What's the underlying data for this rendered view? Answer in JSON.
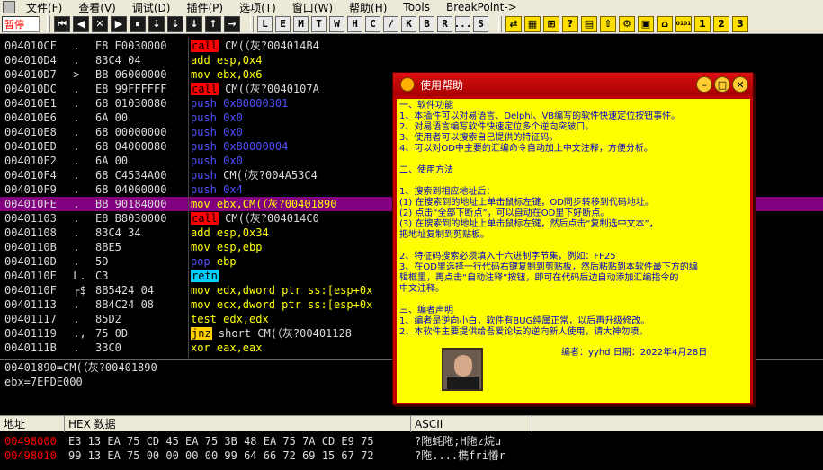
{
  "menu": {
    "items": [
      "文件(F)",
      "查看(V)",
      "调试(D)",
      "插件(P)",
      "选项(T)",
      "窗口(W)",
      "帮助(H)",
      "Tools",
      "BreakPoint->"
    ]
  },
  "toolbar": {
    "status": "暂停",
    "dark_buttons": [
      "⏮",
      "◀",
      "✕",
      "▶",
      "⏸",
      "⇣",
      "⇣",
      "↓",
      "↑",
      "→"
    ],
    "letter_buttons": [
      "L",
      "E",
      "M",
      "T",
      "W",
      "H",
      "C",
      "/",
      "K",
      "B",
      "R",
      "...",
      "S"
    ],
    "yellow_buttons": [
      "⇄",
      "▦",
      "⊞",
      "?",
      "▤",
      "⇧",
      "⚙",
      "▣",
      "⌂",
      "0101",
      "1",
      "2",
      "3"
    ]
  },
  "disasm": {
    "rows": [
      {
        "addr": "004010CF",
        "mark": " .",
        "hex": "E8 E0030000",
        "mn": "call",
        "cls": "kw-call",
        "ops": " CM(（灰?004014B4",
        "ocls": "ops-w"
      },
      {
        "addr": "004010D4",
        "mark": " .",
        "hex": "83C4 04",
        "mn": "add",
        "cls": "ops-y",
        "ops": " esp,0x4",
        "ocls": "ops-y"
      },
      {
        "addr": "004010D7",
        "mark": " >",
        "hex": "BB 06000000",
        "mn": "mov",
        "cls": "ops-y",
        "ops": " ebx,0x6",
        "ocls": "ops-y"
      },
      {
        "addr": "004010DC",
        "mark": " .",
        "hex": "E8 99FFFFFF",
        "mn": "call",
        "cls": "kw-call",
        "ops": " CM(（灰?0040107A",
        "ocls": "ops-w"
      },
      {
        "addr": "004010E1",
        "mark": " .",
        "hex": "68 01030080",
        "mn": "push",
        "cls": "kw-push",
        "ops": " 0x80000301",
        "ocls": "ops-b"
      },
      {
        "addr": "004010E6",
        "mark": " .",
        "hex": "6A 00",
        "mn": "push",
        "cls": "kw-push",
        "ops": " 0x0",
        "ocls": "ops-b"
      },
      {
        "addr": "004010E8",
        "mark": " .",
        "hex": "68 00000000",
        "mn": "push",
        "cls": "kw-push",
        "ops": " 0x0",
        "ocls": "ops-b"
      },
      {
        "addr": "004010ED",
        "mark": " .",
        "hex": "68 04000080",
        "mn": "push",
        "cls": "kw-push",
        "ops": " 0x80000004",
        "ocls": "ops-b"
      },
      {
        "addr": "004010F2",
        "mark": " .",
        "hex": "6A 00",
        "mn": "push",
        "cls": "kw-push",
        "ops": " 0x0",
        "ocls": "ops-b"
      },
      {
        "addr": "004010F4",
        "mark": " .",
        "hex": "68 C4534A00",
        "mn": "push",
        "cls": "kw-push",
        "ops": " CM(（灰?004A53C4",
        "ocls": "ops-w"
      },
      {
        "addr": "004010F9",
        "mark": " .",
        "hex": "68 04000000",
        "mn": "push",
        "cls": "kw-push",
        "ops": " 0x4",
        "ocls": "ops-b"
      },
      {
        "addr": "004010FE",
        "mark": " .",
        "hex": "BB 90184000",
        "mn": "mov",
        "cls": "ops-y",
        "ops": " ebx,CM(（灰?00401890",
        "ocls": "ops-y",
        "sel": true
      },
      {
        "addr": "00401103",
        "mark": " .",
        "hex": "E8 B8030000",
        "mn": "call",
        "cls": "kw-call",
        "ops": " CM(（灰?004014C0",
        "ocls": "ops-w"
      },
      {
        "addr": "00401108",
        "mark": " .",
        "hex": "83C4 34",
        "mn": "add",
        "cls": "ops-y",
        "ops": " esp,0x34",
        "ocls": "ops-y"
      },
      {
        "addr": "0040110B",
        "mark": " .",
        "hex": "8BE5",
        "mn": "mov",
        "cls": "ops-y",
        "ops": " esp,ebp",
        "ocls": "ops-y"
      },
      {
        "addr": "0040110D",
        "mark": " .",
        "hex": "5D",
        "mn": "pop",
        "cls": "kw-push",
        "ops": " ebp",
        "ocls": "ops-y"
      },
      {
        "addr": "0040110E",
        "mark": " L.",
        "hex": "C3",
        "mn": "retn",
        "cls": "kw-ret",
        "ops": "",
        "ocls": "ops-w"
      },
      {
        "addr": "0040110F",
        "mark": " ┌$",
        "hex": "8B5424 04",
        "mn": "mov",
        "cls": "ops-y",
        "ops": " edx,dword ptr ss:[esp+0x",
        "ocls": "ops-y"
      },
      {
        "addr": "00401113",
        "mark": " .",
        "hex": "8B4C24 08",
        "mn": "mov",
        "cls": "ops-y",
        "ops": " ecx,dword ptr ss:[esp+0x",
        "ocls": "ops-y"
      },
      {
        "addr": "00401117",
        "mark": " .",
        "hex": "85D2",
        "mn": "test",
        "cls": "ops-y",
        "ops": " edx,edx",
        "ocls": "ops-y"
      },
      {
        "addr": "00401119",
        "mark": " .,",
        "hex": "75 0D",
        "mn": "jnz",
        "cls": "kw-jnz",
        "ops": " short CM(（灰?00401128",
        "ocls": "ops-w"
      },
      {
        "addr": "0040111B",
        "mark": " .",
        "hex": "33C0",
        "mn": "xor",
        "cls": "ops-y",
        "ops": " eax,eax",
        "ocls": "ops-y"
      }
    ]
  },
  "info": {
    "line1": "00401890=CM(（灰?00401890",
    "line2": "ebx=7EFDE000"
  },
  "dump": {
    "col_addr": "地址",
    "col_hex": "HEX 数据",
    "col_ascii": "ASCII",
    "rows": [
      {
        "addr": "00498000",
        "hex": "E3 13 EA 75 CD 45 EA 75 3B 48 EA 75 7A CD E9 75",
        "ascii": "?陁蚝陁;H陁z烷u"
      },
      {
        "addr": "00498010",
        "hex": "99 13 EA 75 00 00 00 00 99 64 66 72 69 15 67 72",
        "ascii": "?陁....檇fri慻r"
      }
    ]
  },
  "help": {
    "title": "使用帮助",
    "lines": [
      "一、软件功能",
      "1、本插件可以对易语言、Delphi、VB编写的软件快速定位按钮事件。",
      "2、对易语言编写软件快速定位多个逆向突破口。",
      "3、使用者可以搜索自己提供的特征码。",
      "4、可以对OD中主要的汇编命令自动加上中文注释，方便分析。",
      "",
      "二、使用方法",
      "",
      "1、搜索到相应地址后：",
      "   (1) 在搜索到的地址上单击鼠标左键，OD同步转移到代码地址。",
      "   (2) 点击“全部下断点”，可以自动在OD里下好断点。",
      "   (3) 在搜索到的地址上单击鼠标左键，然后点击“复制选中文本”，",
      "把地址复制到剪贴板。",
      "",
      "2、特征码搜索必须填入十六进制字节集，例如：FF25",
      "3、在OD里选择一行代码右键复制到剪贴板，然后粘贴到本软件最下方的编",
      "辑框里，再点击“自动注释”按钮，即可在代码后边自动添加汇编指令的",
      "中文注释。",
      "",
      "三、编者声明",
      "1、编者是逆向小白，软件有BUG纯属正常，以后再升级修改。",
      "2、本软件主要提供给吾爱论坛的逆向新人使用，请大神勿喷。"
    ],
    "author": "编者：yyhd  日期：2022年4月28日"
  }
}
